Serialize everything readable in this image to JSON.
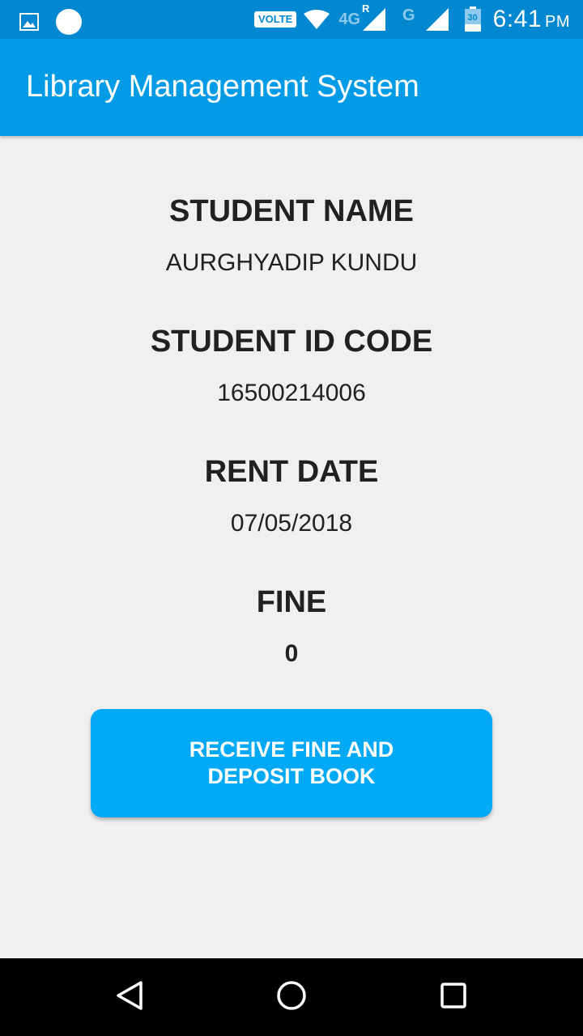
{
  "status_bar": {
    "volte": "VOLTE",
    "net_4g": "4G",
    "roaming": "R",
    "net_g": "G",
    "battery": "30",
    "time": "6:41",
    "ampm": "PM",
    "icons": [
      "gallery-icon",
      "circle-icon",
      "wifi-icon",
      "signal-icon",
      "battery-icon"
    ]
  },
  "app_bar": {
    "title": "Library Management System"
  },
  "details": {
    "student_name_label": "STUDENT NAME",
    "student_name_value": "AURGHYADIP KUNDU",
    "student_id_label": "STUDENT ID CODE",
    "student_id_value": "16500214006",
    "rent_date_label": "RENT DATE",
    "rent_date_value": "07/05/2018",
    "fine_label": "FINE",
    "fine_value": "0"
  },
  "action": {
    "button_label": "RECEIVE FINE AND DEPOSIT BOOK"
  },
  "nav_bar": {
    "icons": [
      "back-icon",
      "home-icon",
      "recents-icon"
    ]
  },
  "colors": {
    "status_bar": "#0288d1",
    "app_bar": "#039be5",
    "button": "#03a9f4",
    "background": "#f0f0f0"
  }
}
